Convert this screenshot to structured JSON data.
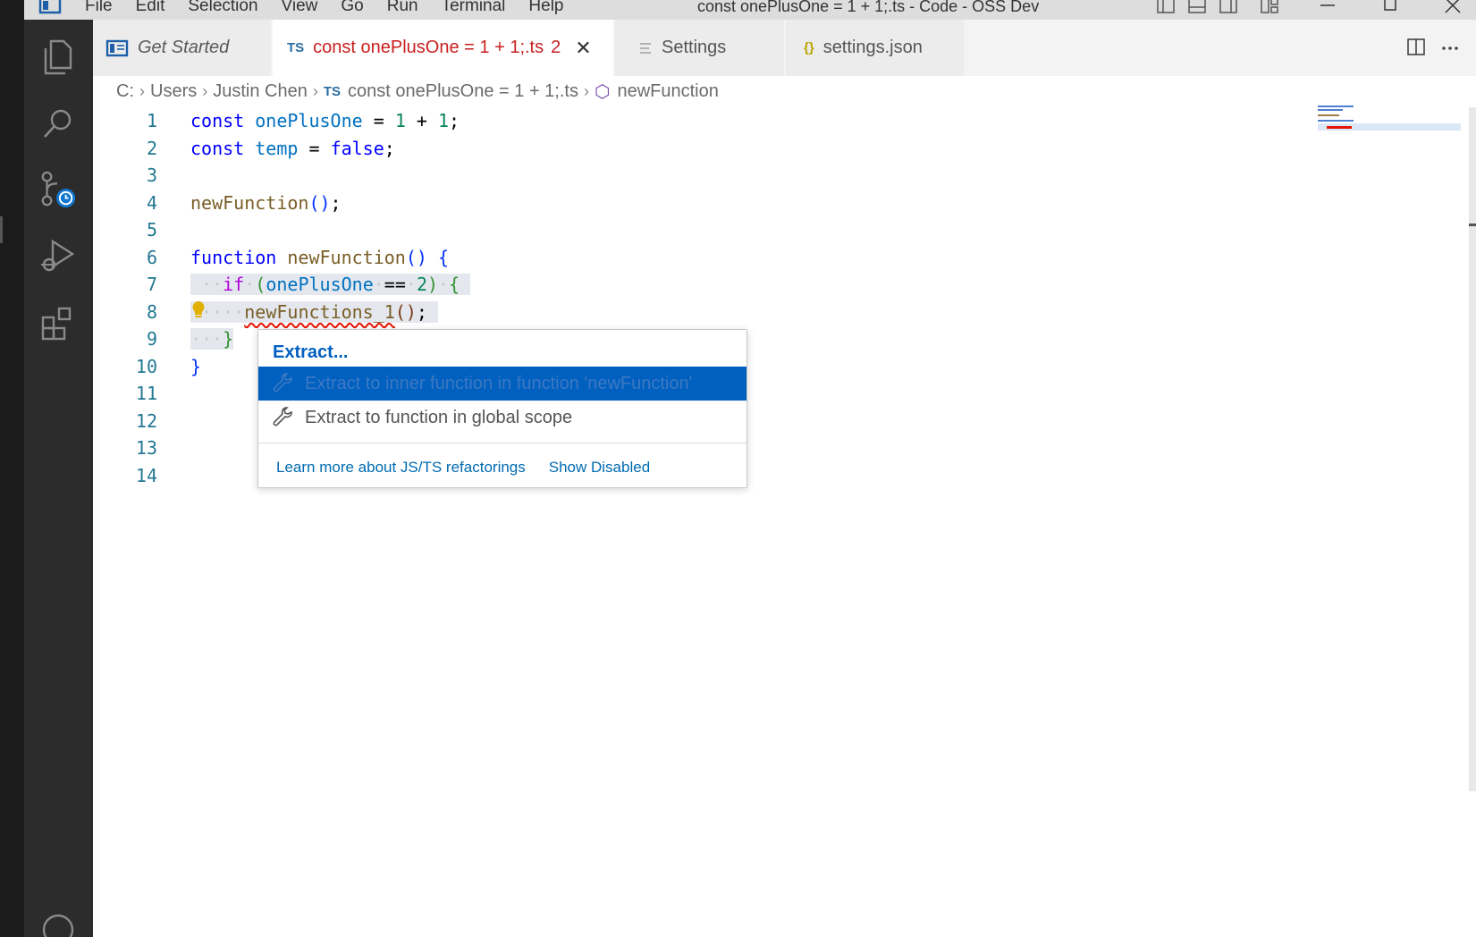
{
  "titlebar": {
    "menu": [
      "File",
      "Edit",
      "Selection",
      "View",
      "Go",
      "Run",
      "Terminal",
      "Help"
    ],
    "window_title": "const onePlusOne = 1 + 1;.ts - Code - OSS Dev"
  },
  "tabs": [
    {
      "label": "Get Started"
    },
    {
      "icon_text": "TS",
      "label": "const onePlusOne = 1 + 1;.ts",
      "badge": "2",
      "close": "✕"
    },
    {
      "label": "Settings"
    },
    {
      "icon_text": "{}",
      "label": "settings.json"
    }
  ],
  "breadcrumb": {
    "items": [
      "C:",
      "Users",
      "Justin Chen"
    ],
    "ts_label": "TS",
    "file": "const onePlusOne = 1 + 1;.ts",
    "symbol": "newFunction"
  },
  "editor": {
    "line_numbers": [
      "1",
      "2",
      "3",
      "4",
      "5",
      "6",
      "7",
      "8",
      "9",
      "10",
      "11",
      "12",
      "13",
      "14"
    ]
  },
  "code_action": {
    "header": "Extract...",
    "items": [
      {
        "label": "Extract to inner function in function 'newFunction'",
        "selected": true
      },
      {
        "label": "Extract to function in global scope",
        "selected": false
      }
    ],
    "footer": {
      "learn_more": "Learn more about JS/TS refactorings",
      "show_disabled": "Show Disabled"
    }
  },
  "colors": {
    "accent": "#0060c0",
    "error": "#e51400",
    "tab_active_text": "#c81f1f"
  }
}
